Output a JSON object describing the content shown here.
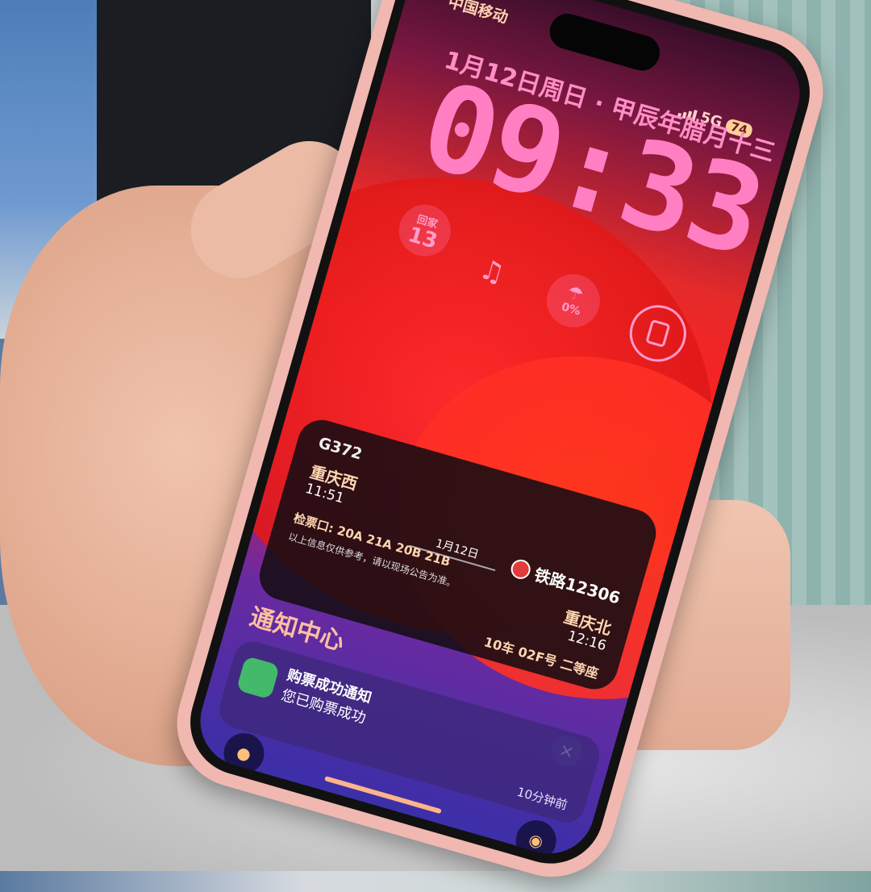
{
  "status_bar": {
    "carrier": "中国移动",
    "network": "5G",
    "battery": "74"
  },
  "lock_screen": {
    "date": "1月12日周日 · 甲辰年腊月十三",
    "time": "09:33"
  },
  "widgets": {
    "countdown_label": "回家",
    "countdown_value": "13",
    "calendar_icon": "calendar-music-icon",
    "rain_icon": "umbrella-icon",
    "rain_value": "0%",
    "watch_icon": "watch-icon"
  },
  "ticket": {
    "train": "G372",
    "from_station": "重庆西",
    "depart_time": "11:51",
    "travel_date": "1月12日",
    "app_logo": "铁路12306",
    "gate": "检票口: 20A 21A 20B 21B",
    "note": "以上信息仅供参考，请以现场公告为准。",
    "to_station": "重庆北",
    "arrive_time": "12:16",
    "seat": "10车 02F号 二等座"
  },
  "notification_center": {
    "title": "通知中心",
    "item": {
      "title": "购票成功通知",
      "body": "您已购票成功",
      "time_ago": "10分钟前"
    }
  },
  "controls": {
    "close": "×",
    "flashlight_icon": "flashlight-icon",
    "camera_icon": "camera-icon"
  }
}
